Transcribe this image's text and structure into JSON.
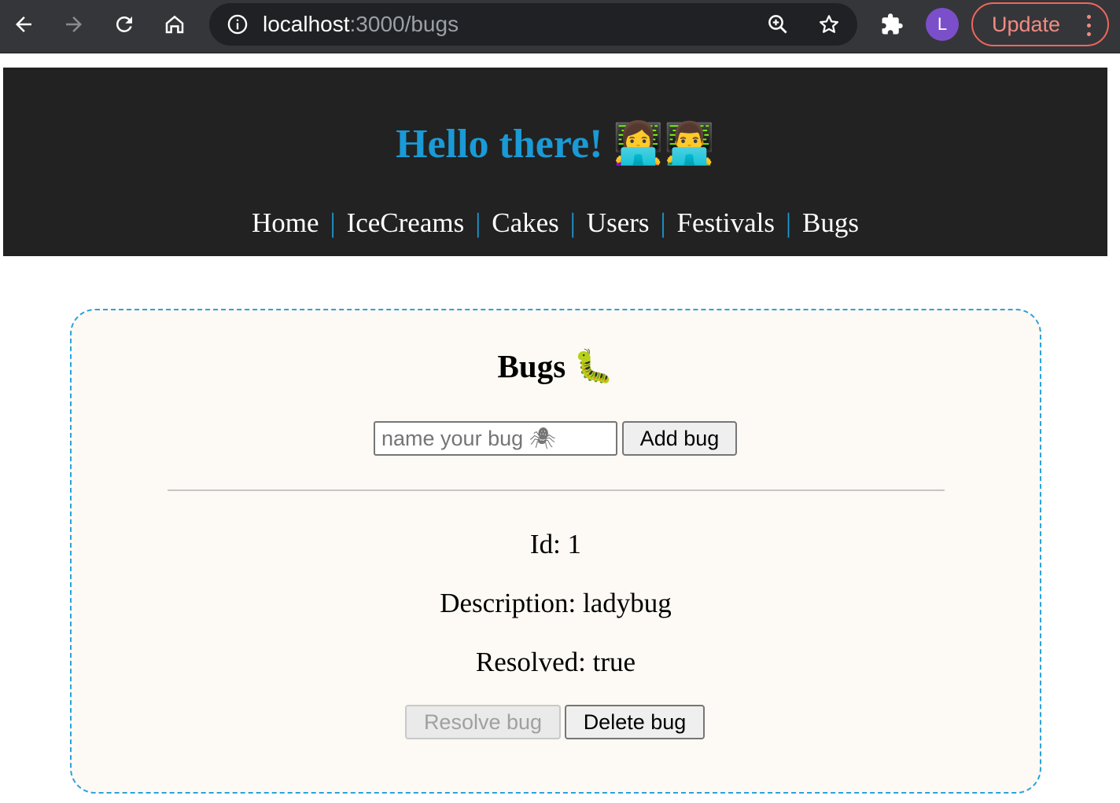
{
  "browser": {
    "url_host": "localhost",
    "url_path": ":3000/bugs",
    "profile_initial": "L",
    "update_label": "Update"
  },
  "header": {
    "title": "Hello there! 👩‍💻👨‍💻",
    "nav": [
      "Home",
      "IceCreams",
      "Cakes",
      "Users",
      "Festivals",
      "Bugs"
    ],
    "separator": "|"
  },
  "bugs": {
    "heading": "Bugs 🐛",
    "input_placeholder": "name your bug 🕷",
    "add_label": "Add bug",
    "items": [
      {
        "id_text": "Id: 1",
        "description_text": "Description: ladybug",
        "resolved_text": "Resolved: true",
        "resolve_label": "Resolve bug",
        "delete_label": "Delete bug"
      }
    ]
  },
  "colors": {
    "accent": "#1a9ad6",
    "header_bg": "#222222",
    "card_bg": "#fdf9f4",
    "card_border": "#29a3dc"
  },
  "icons": [
    "back-arrow-icon",
    "forward-arrow-icon",
    "reload-icon",
    "home-icon",
    "site-info-icon",
    "zoom-icon",
    "bookmark-star-icon",
    "extensions-puzzle-icon",
    "more-dots-icon"
  ]
}
